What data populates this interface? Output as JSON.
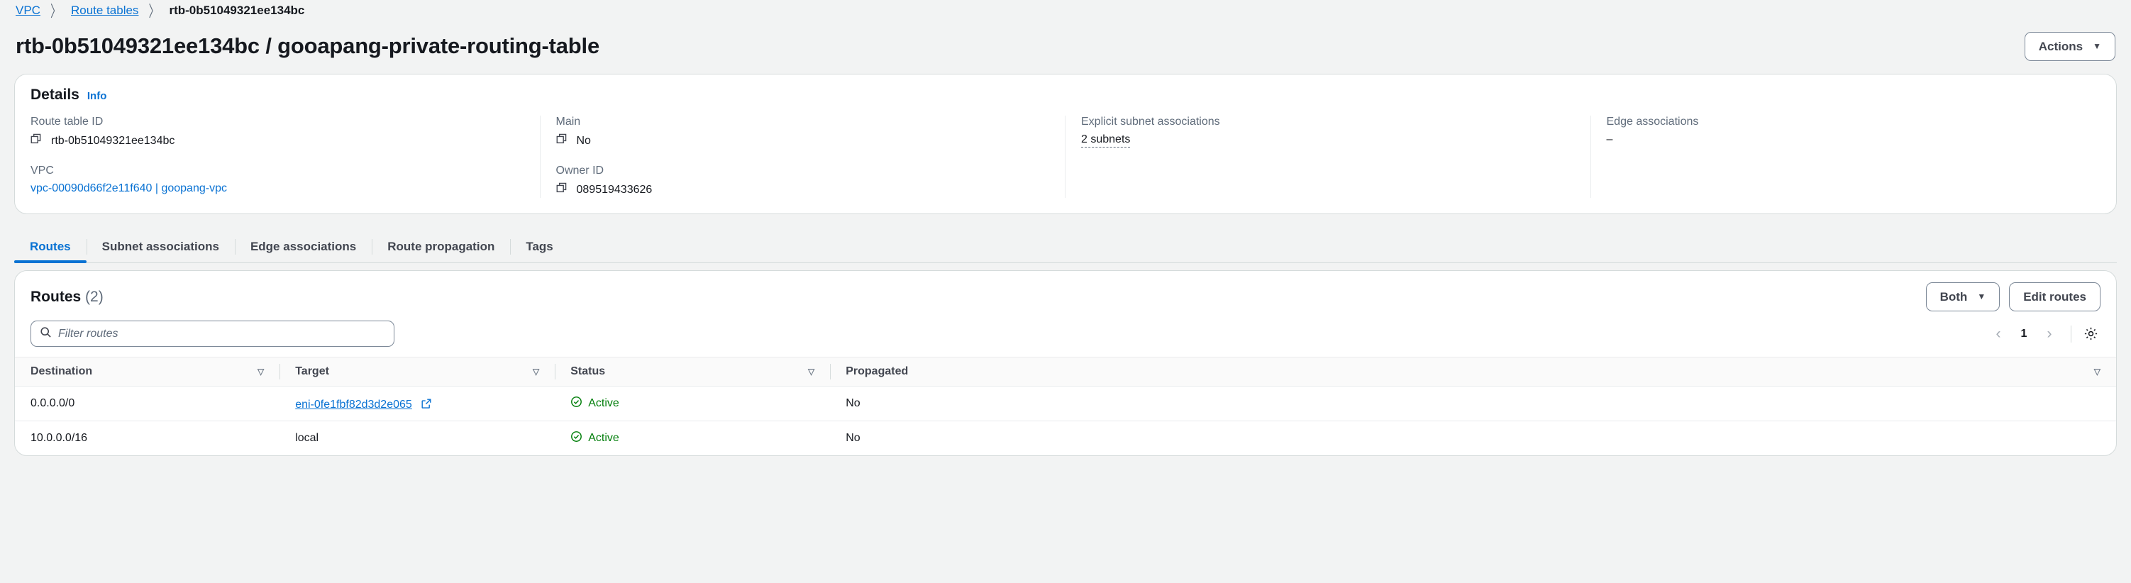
{
  "breadcrumb": {
    "items": [
      {
        "label": "VPC",
        "type": "link"
      },
      {
        "label": "Route tables",
        "type": "link"
      },
      {
        "label": "rtb-0b51049321ee134bc",
        "type": "current"
      }
    ],
    "separator": "〉"
  },
  "header": {
    "title": "rtb-0b51049321ee134bc / gooapang-private-routing-table",
    "actions_label": "Actions",
    "actions_caret": "▼"
  },
  "details": {
    "title": "Details",
    "info_label": "Info",
    "fields": [
      {
        "label": "Route table ID",
        "value": "rtb-0b51049321ee134bc",
        "kind": "copyable",
        "icon": "copy-icon"
      },
      {
        "label": "VPC",
        "value": "vpc-00090d66f2e11f640 | goopang-vpc",
        "kind": "link"
      },
      {
        "label": "Main",
        "value": "No",
        "kind": "copyable",
        "icon": "copy-icon"
      },
      {
        "label": "Owner ID",
        "value": "089519433626",
        "kind": "copyable",
        "icon": "copy-icon"
      },
      {
        "label": "Explicit subnet associations",
        "value": "2 subnets",
        "kind": "popover"
      },
      {
        "label": "Edge associations",
        "value": "–",
        "kind": "plain"
      }
    ]
  },
  "tabs": [
    {
      "label": "Routes",
      "active": true
    },
    {
      "label": "Subnet associations",
      "active": false
    },
    {
      "label": "Edge associations",
      "active": false
    },
    {
      "label": "Route propagation",
      "active": false
    },
    {
      "label": "Tags",
      "active": false
    }
  ],
  "routes": {
    "title": "Routes",
    "count": "(2)",
    "filter_placeholder": "Filter routes",
    "filter_value": "",
    "scope_select": {
      "value": "Both",
      "caret": "▼"
    },
    "edit_label": "Edit routes",
    "pagination": {
      "prev": "‹",
      "page": "1",
      "next": "›"
    },
    "columns": [
      {
        "label": "Destination",
        "sortable": true
      },
      {
        "label": "Target",
        "sortable": true
      },
      {
        "label": "Status",
        "sortable": true
      },
      {
        "label": "Propagated",
        "sortable": true
      }
    ],
    "rows": [
      {
        "destination": "0.0.0.0/0",
        "target": "eni-0fe1fbf82d3d2e065",
        "target_is_link": true,
        "status": "Active",
        "propagated": "No"
      },
      {
        "destination": "10.0.0.0/16",
        "target": "local",
        "target_is_link": false,
        "status": "Active",
        "propagated": "No"
      }
    ]
  },
  "colors": {
    "link": "#0972d3",
    "status_active": "#037f0c",
    "text": "#16191f",
    "muted": "#5f6b7a",
    "page_bg": "#f2f3f3"
  }
}
